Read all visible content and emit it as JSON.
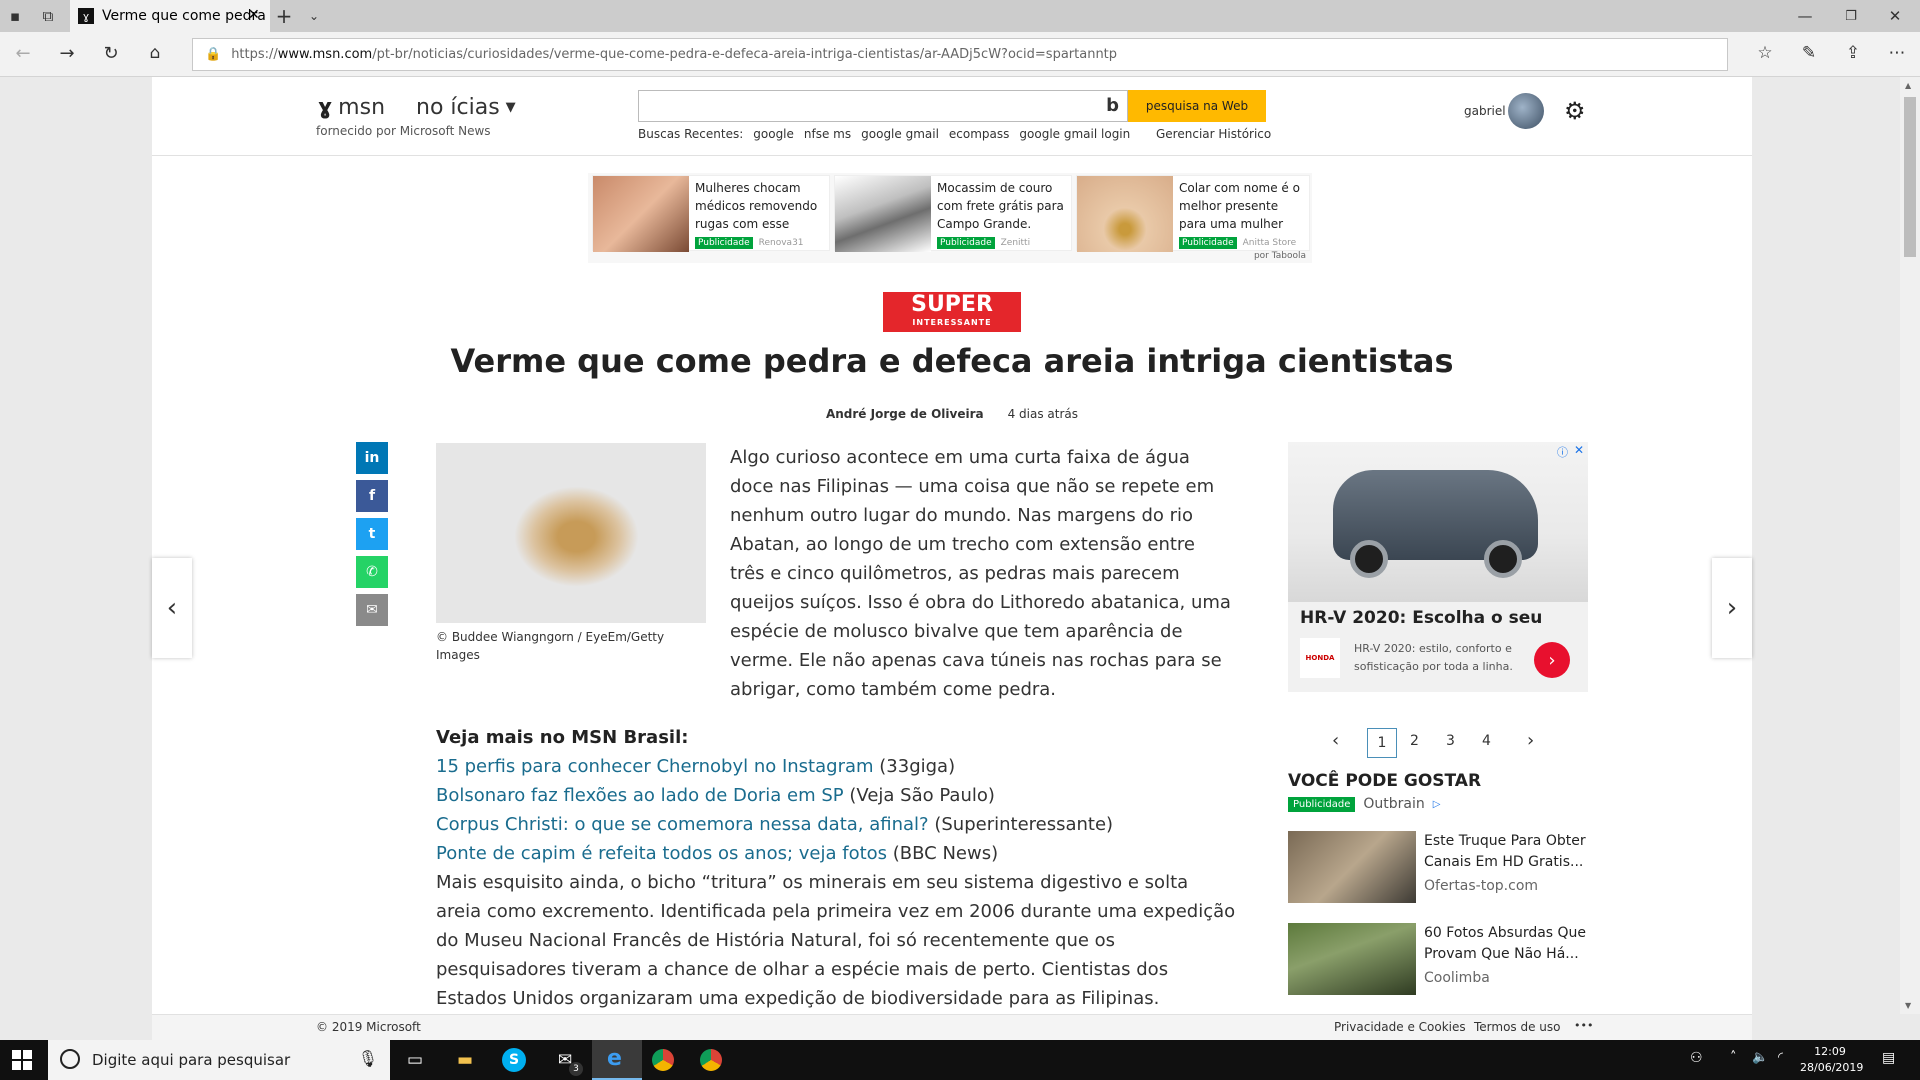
{
  "browser": {
    "tab_title": "Verme que come pedra",
    "url_prefix": "https://",
    "url_host": "www.msn.com",
    "url_path": "/pt-br/noticias/curiosidades/verme-que-come-pedra-e-defeca-areia-intriga-cientistas/ar-AADj5cW?ocid=spartanntp"
  },
  "msn_header": {
    "logo_text": "msn",
    "section": "no ícias",
    "provider": "fornecido por Microsoft News",
    "search_button": "pesquisa na Web",
    "recent_label": "Buscas Recentes:",
    "recent_searches": [
      "google",
      "nfse ms",
      "google gmail",
      "ecompass",
      "google gmail login"
    ],
    "manage_history": "Gerenciar Histórico",
    "username": "gabriel"
  },
  "ads": [
    {
      "text": "Mulheres chocam médicos removendo rugas com esse truque",
      "badge": "Publicidade",
      "source": "Renova31"
    },
    {
      "text": "Mocassim de couro com frete grátis para Campo Grande. Apro...",
      "badge": "Publicidade",
      "source": "Zenitti"
    },
    {
      "text": "Colar com nome é o melhor presente para uma mulher",
      "badge": "Publicidade",
      "source": "Anitta Store"
    }
  ],
  "ads_credit": "por Taboola",
  "article": {
    "publisher_logo": "SUPER",
    "publisher_logo_sub": "INTERESSANTE",
    "title": "Verme que come pedra e defeca areia intriga cientistas",
    "author": "André Jorge de Oliveira",
    "time": "4 dias atrás",
    "image_caption": "© Buddee Wiangngorn / EyeEm/Getty Images",
    "para1": "Algo curioso acontece em uma curta faixa de água doce nas Filipinas — uma coisa que não se repete em nenhum outro lugar do mundo. Nas margens do rio Abatan, ao longo de um trecho com extensão entre três e cinco quilômetros, as pedras mais parecem queijos suíços. Isso é obra do Lithoredo abatanica, uma espécie de molusco bivalve que tem aparência de verme. Ele não apenas cava túneis nas rochas para se abrigar, como também come pedra.",
    "see_more": "Veja mais no MSN Brasil:",
    "related": [
      {
        "title": "15 perfis para conhecer Chernobyl no Instagram",
        "source": "(33giga)"
      },
      {
        "title": "Bolsonaro faz flexões ao lado de Doria em SP",
        "source": "(Veja São Paulo)"
      },
      {
        "title": "Corpus Christi: o que se comemora nessa data, afinal?",
        "source": "(Superinteressante)"
      },
      {
        "title": "Ponte de capim é refeita todos os anos; veja fotos",
        "source": "(BBC News)"
      }
    ],
    "para2": "Mais esquisito ainda, o bicho “tritura” os minerais em seu sistema digestivo e solta areia como excremento. Identificada pela primeira vez em 2006 durante uma expedição do Museu Nacional Francês de História Natural, foi só recentemente que os pesquisadores tiveram a chance de olhar a espécie mais de perto. Cientistas dos Estados Unidos organizaram uma expedição de biodiversidade para as Filipinas."
  },
  "side_ad": {
    "title": "HR-V 2020: Escolha o seu",
    "desc": "HR-V 2020: estilo, conforto e sofisticação por toda a linha.",
    "brand": "HONDA"
  },
  "pagination": [
    "1",
    "2",
    "3",
    "4"
  ],
  "recommend": {
    "heading": "VOCÊ PODE GOSTAR",
    "badge": "Publicidade",
    "provider": "Outbrain",
    "items": [
      {
        "title": "Este Truque Para Obter Canais Em HD Gratis...",
        "source": "Ofertas-top.com"
      },
      {
        "title": "60 Fotos Absurdas Que Provam Que Não Há...",
        "source": "Coolimba"
      }
    ]
  },
  "footer": {
    "copyright": "© 2019 Microsoft",
    "privacy": "Privacidade e Cookies",
    "terms": "Termos de uso",
    "more": "•••"
  },
  "taskbar": {
    "search_placeholder": "Digite aqui para pesquisar",
    "mail_badge": "3",
    "time": "12:09",
    "date": "28/06/2019"
  }
}
